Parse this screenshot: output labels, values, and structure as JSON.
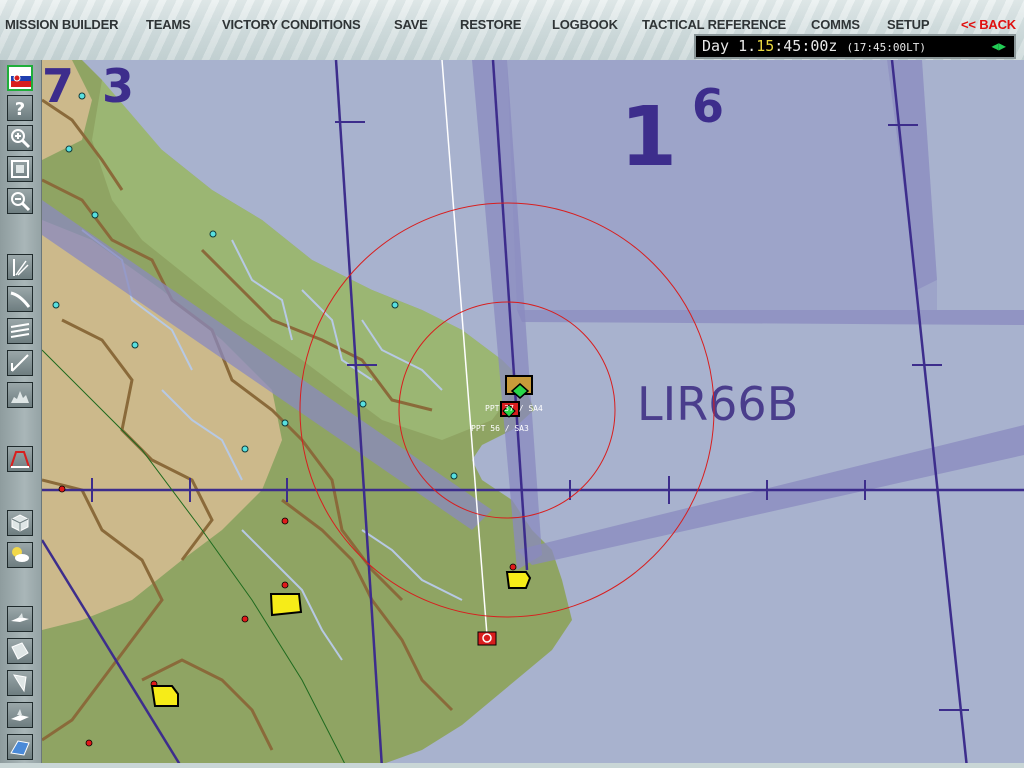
{
  "menu": {
    "items": [
      {
        "id": "mission-builder",
        "label": "MISSION BUILDER"
      },
      {
        "id": "teams",
        "label": "TEAMS"
      },
      {
        "id": "victory-conditions",
        "label": "VICTORY CONDITIONS"
      },
      {
        "id": "save",
        "label": "SAVE"
      },
      {
        "id": "restore",
        "label": "RESTORE"
      },
      {
        "id": "logbook",
        "label": "LOGBOOK"
      },
      {
        "id": "tactical-reference",
        "label": "TACTICAL REFERENCE"
      },
      {
        "id": "comms",
        "label": "COMMS"
      },
      {
        "id": "setup",
        "label": "SETUP"
      }
    ],
    "back_label": "<< BACK"
  },
  "clock": {
    "day_label": "Day",
    "day": "1",
    "hours": "15",
    "rest": ":45:00z",
    "local": "(17:45:00LT)"
  },
  "sidebar": {
    "tools": [
      "flag-icon",
      "help-icon",
      "zoom-in-icon",
      "fit-map-icon",
      "zoom-out-icon",
      "threat-circles-icon",
      "route-icon",
      "airspace-icon",
      "bullseye-icon",
      "radar-profile-icon",
      "elevation-profile-icon",
      "object-layer-icon",
      "weather-icon",
      "aircraft-icon",
      "ground-unit-icon",
      "navy-icon",
      "flight-icon",
      "airbase-icon"
    ]
  },
  "map": {
    "grid_numbers": [
      "1",
      "6",
      "7",
      "3"
    ],
    "airspace_label": "LIR66B",
    "ppt_labels": [
      "PPT 37 / SA4",
      "PPT 56 / SA3"
    ]
  },
  "colors": {
    "land": "#b8ad86",
    "sea": "#a8b2ce",
    "grid": "#3d2d8c",
    "airspace": "#8a8abf",
    "threat_ring": "#d81e1e",
    "city": "#f6ec18"
  }
}
